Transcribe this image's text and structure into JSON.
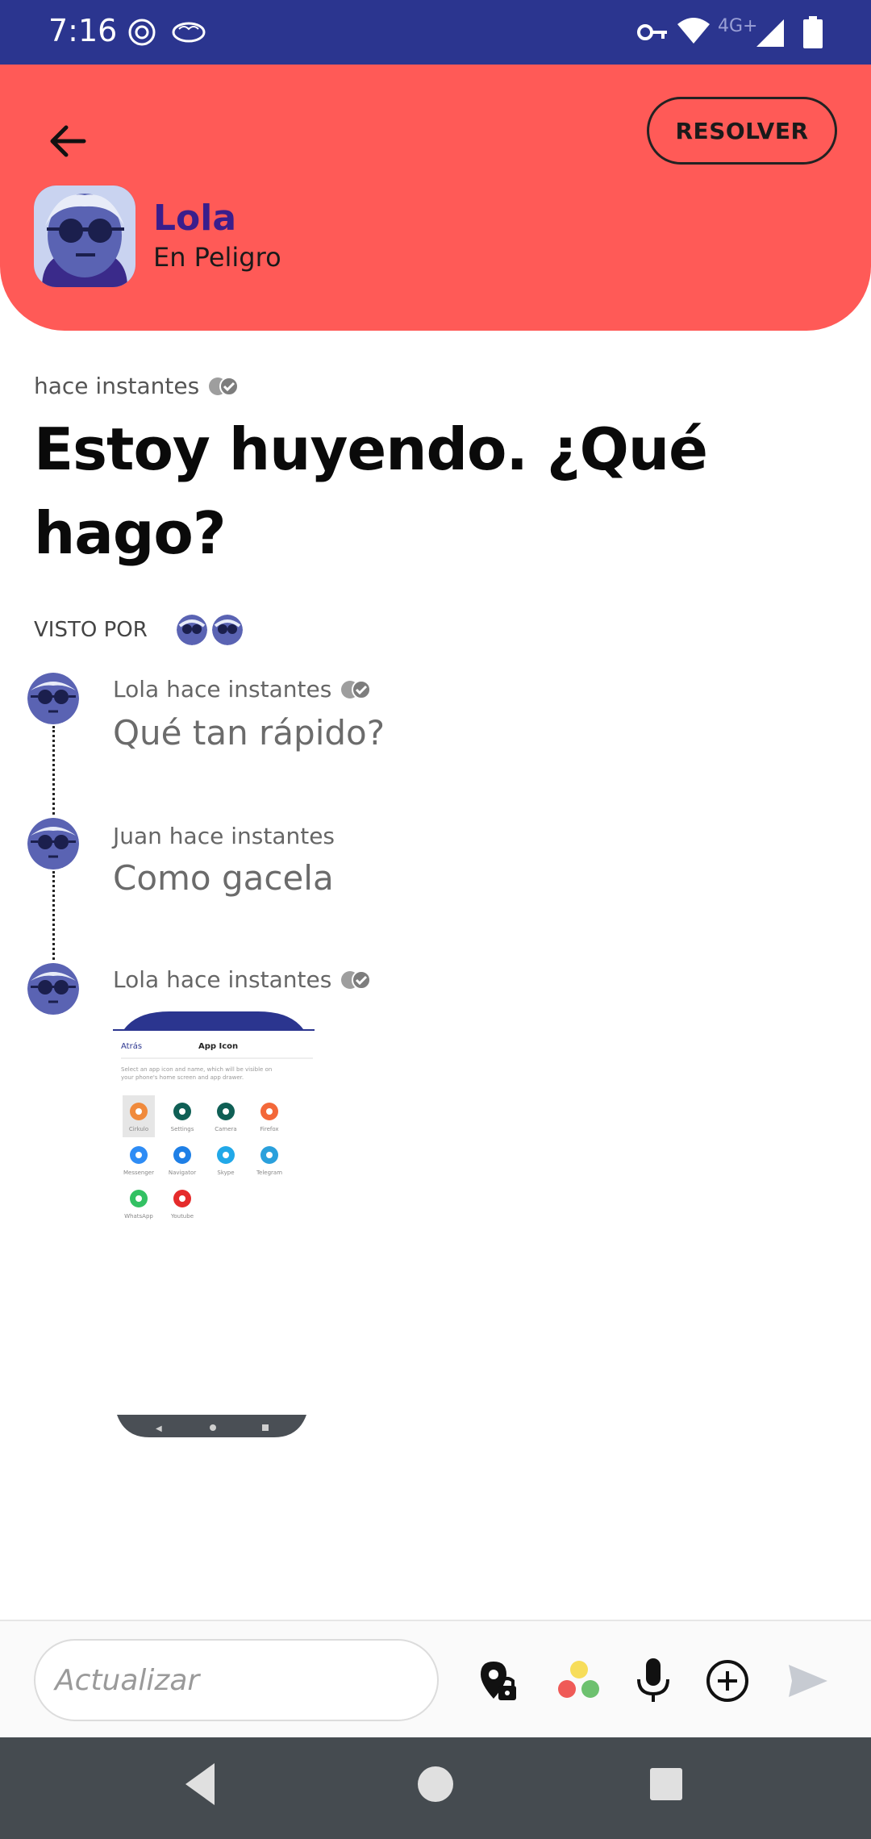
{
  "status_bar": {
    "time": "7:16",
    "network": "4G+"
  },
  "header": {
    "resolve_label": "RESOLVER",
    "contact_name": "Lola",
    "contact_status": "En Peligro",
    "accent_color": "#ff5a57"
  },
  "alert": {
    "time": "hace instantes",
    "headline": "Estoy huyendo.  ¿Qué hago?",
    "seen_by_label": "VISTO POR"
  },
  "messages": [
    {
      "author_time": "Lola hace instantes",
      "text": "Qué tan rápido?",
      "read_receipt": true
    },
    {
      "author_time": "Juan hace instantes",
      "text": "Como gacela",
      "read_receipt": false
    },
    {
      "author_time": "Lola hace instantes",
      "text": "",
      "read_receipt": true,
      "attachment": "screenshot"
    }
  ],
  "attachment": {
    "back_label": "Atrás",
    "title": "App Icon",
    "description": "Select an app icon and name, which will be visible on your phone's home screen and app drawer.",
    "apps": [
      {
        "label": "Cirkulo",
        "color": "#f08a3c"
      },
      {
        "label": "Settings",
        "color": "#0f5f55"
      },
      {
        "label": "Camera",
        "color": "#0f5f55"
      },
      {
        "label": "Firefox",
        "color": "#f3683a"
      },
      {
        "label": "Messenger",
        "color": "#2e8cf5"
      },
      {
        "label": "Navigator",
        "color": "#1e7fe6"
      },
      {
        "label": "Skype",
        "color": "#21a8e8"
      },
      {
        "label": "Telegram",
        "color": "#2aa0dc"
      },
      {
        "label": "WhatsApp",
        "color": "#33c163"
      },
      {
        "label": "Youtube",
        "color": "#e52b2b"
      }
    ]
  },
  "composer": {
    "placeholder": "Actualizar"
  }
}
